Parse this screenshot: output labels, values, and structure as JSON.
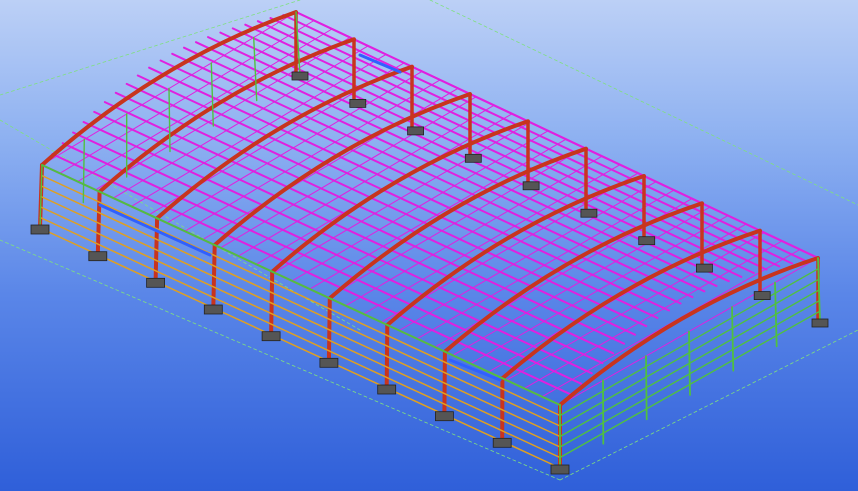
{
  "scene": {
    "background_top": "#bcd0f6",
    "background_bottom": "#2f5fd9",
    "grid_color": "#7fe07f",
    "colors": {
      "rafter": "#c8341e",
      "column": "#c8341e",
      "purlin": "#e020e0",
      "girt": "#e0a020",
      "wall_frame": "#50c040",
      "base_plate": "#555555",
      "brace": "#3060ff"
    },
    "frame_count": 10
  }
}
